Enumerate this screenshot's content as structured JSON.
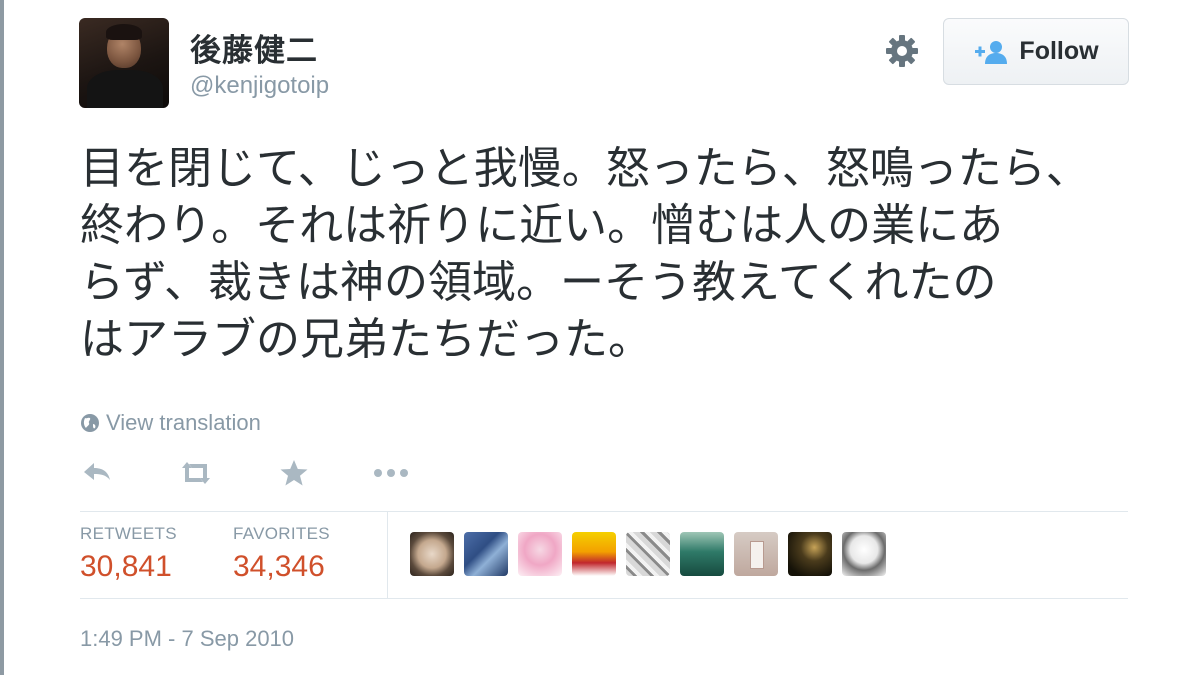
{
  "user": {
    "display_name": "後藤健二",
    "username": "@kenjigotoip"
  },
  "follow_button": {
    "label": "Follow"
  },
  "tweet": {
    "text": "目を閉じて、じっと我慢。怒ったら、怒鳴ったら、\n終わり。それは祈りに近い。憎むは人の業にあ\nらず、裁きは神の領域。ーそう教えてくれたの\nはアラブの兄弟たちだった。",
    "view_translation": "View translation",
    "timestamp": "1:49 PM - 7 Sep 2010"
  },
  "actions": {
    "icons": [
      "reply-icon",
      "retweet-icon",
      "favorite-icon",
      "more-icon"
    ]
  },
  "stats": {
    "retweets_label": "RETWEETS",
    "retweets_value": "30,841",
    "favorites_label": "FAVORITES",
    "favorites_value": "34,346"
  },
  "colors": {
    "text": "#292f33",
    "muted": "#8899a6",
    "count": "#d0502b",
    "divider": "#e1e8ed",
    "follow_icon": "#55acee"
  }
}
